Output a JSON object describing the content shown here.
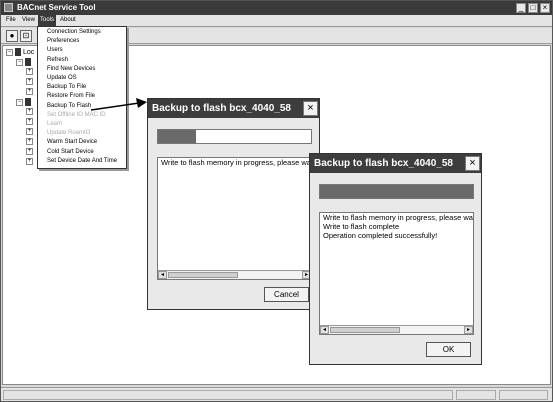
{
  "app": {
    "title": "BACnet Service Tool",
    "menus": [
      "File",
      "View",
      "Tools",
      "About"
    ],
    "toolbar_icons": [
      "connect-icon",
      "device-icon"
    ]
  },
  "tree": {
    "root_label": "Loc",
    "rows": [
      "",
      "",
      "",
      "",
      "",
      "",
      "",
      "",
      "",
      "",
      "",
      "",
      ""
    ]
  },
  "tools_menu": {
    "items": [
      {
        "label": "Connection Settings",
        "enabled": true
      },
      {
        "label": "Preferences",
        "enabled": true
      },
      {
        "label": "Users",
        "enabled": true
      },
      {
        "label": "Refresh",
        "enabled": true
      },
      {
        "label": "Find New Devices",
        "enabled": true
      },
      {
        "label": "Update OS",
        "enabled": true
      },
      {
        "label": "Backup To File",
        "enabled": true
      },
      {
        "label": "Restore From File",
        "enabled": true
      },
      {
        "label": "Backup To Flash",
        "enabled": true
      },
      {
        "label": "Set Offline IO MAC ID",
        "enabled": false
      },
      {
        "label": "Learn",
        "enabled": false
      },
      {
        "label": "Update RoamIO",
        "enabled": false
      },
      {
        "label": "Warm Start Device",
        "enabled": true
      },
      {
        "label": "Cold Start Device",
        "enabled": true
      },
      {
        "label": "Set Device Date And Time",
        "enabled": true
      }
    ]
  },
  "dialog_progress": {
    "title": "Backup to flash bcx_4040_58",
    "progress": 0.25,
    "log": [
      "Write to flash memory in progress, please wai"
    ],
    "button": "Cancel"
  },
  "dialog_complete": {
    "title": "Backup to flash bcx_4040_58",
    "progress": 1.0,
    "log": [
      "Write to flash memory in progress, please wai",
      "Write to flash complete",
      "Operation completed successfully!"
    ],
    "button": "OK"
  }
}
